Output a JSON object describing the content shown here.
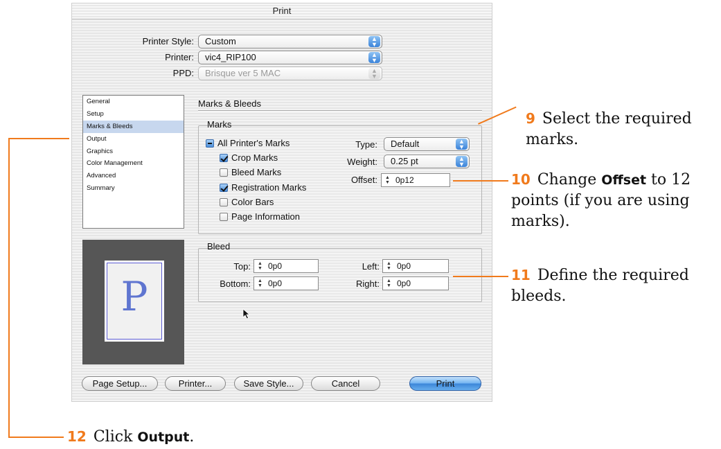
{
  "dialog": {
    "title": "Print",
    "printer_style": {
      "label": "Printer Style:",
      "value": "Custom"
    },
    "printer": {
      "label": "Printer:",
      "value": "vic4_RIP100"
    },
    "ppd": {
      "label": "PPD:",
      "value": "Brisque ver 5 MAC"
    },
    "sidebar": {
      "items": [
        {
          "label": "General"
        },
        {
          "label": "Setup"
        },
        {
          "label": "Marks & Bleeds"
        },
        {
          "label": "Output"
        },
        {
          "label": "Graphics"
        },
        {
          "label": "Color Management"
        },
        {
          "label": "Advanced"
        },
        {
          "label": "Summary"
        }
      ],
      "selected": "Marks & Bleeds"
    },
    "section_title": "Marks & Bleeds",
    "marks": {
      "group_title": "Marks",
      "all_printers_marks": "All Printer's Marks",
      "crop_marks": "Crop Marks",
      "bleed_marks": "Bleed Marks",
      "registration_marks": "Registration Marks",
      "color_bars": "Color Bars",
      "page_information": "Page Information",
      "type": {
        "label": "Type:",
        "value": "Default"
      },
      "weight": {
        "label": "Weight:",
        "value": "0.25 pt"
      },
      "offset": {
        "label": "Offset:",
        "value": "0p12"
      }
    },
    "bleed": {
      "group_title": "Bleed",
      "top": {
        "label": "Top:",
        "value": "0p0"
      },
      "bottom": {
        "label": "Bottom:",
        "value": "0p0"
      },
      "left": {
        "label": "Left:",
        "value": "0p0"
      },
      "right": {
        "label": "Right:",
        "value": "0p0"
      }
    },
    "preview_letter": "P",
    "buttons": {
      "page_setup": "Page Setup...",
      "printer": "Printer...",
      "save_style": "Save Style...",
      "cancel": "Cancel",
      "print": "Print"
    }
  },
  "callouts": {
    "c9": {
      "num": "9",
      "text": "Select the required marks."
    },
    "c10": {
      "num": "10",
      "pre": "Change ",
      "bold": "Offset",
      "post": " to 12 points (if you are using marks)."
    },
    "c11": {
      "num": "11",
      "text": "Define the required bleeds."
    },
    "c12": {
      "num": "12",
      "pre": "Click ",
      "bold": "Output",
      "post": "."
    }
  },
  "colors": {
    "accent": "#f07a1c",
    "selection": "#c7d7ee",
    "default_button": "#3a85d8"
  }
}
